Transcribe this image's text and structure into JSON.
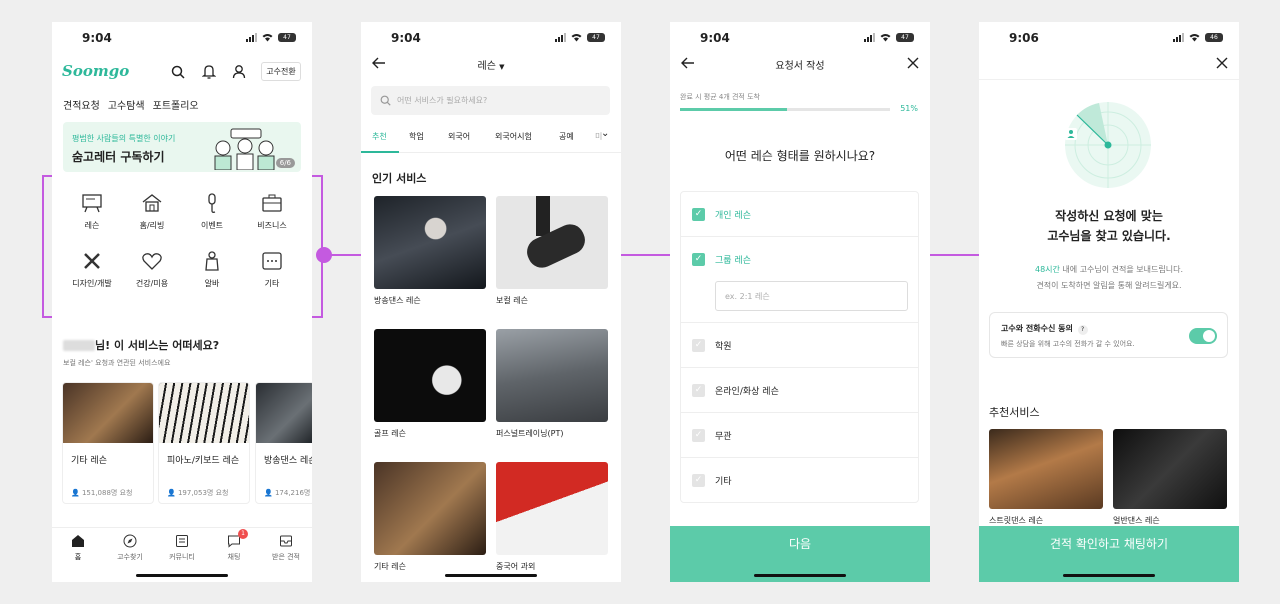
{
  "screens": [
    {
      "status_time": "9:04",
      "battery": "47",
      "logo": "Soomgo",
      "mode_switch": "고수전환",
      "tabs": [
        "견적요청",
        "고수탐색",
        "포트폴리오"
      ],
      "banner": {
        "subtitle": "평범한 사람들의 특별한 이야기",
        "title": "숨고레터 구독하기",
        "page": "6/6"
      },
      "categories": [
        "레슨",
        "홈/리빙",
        "이벤트",
        "비즈니스",
        "디자인/개발",
        "건강/미용",
        "알바",
        "기타"
      ],
      "rec_title": "님! 이 서비스는 어떠세요?",
      "rec_sub": "보컬 레슨' 요청과 연관된 서비스에요",
      "cards": [
        {
          "title": "기타 레슨",
          "count": "151,088명 요청"
        },
        {
          "title": "피아노/키보드 레슨",
          "count": "197,053명 요청"
        },
        {
          "title": "방송댄스 레슨",
          "count": "174,216명"
        }
      ],
      "nav": [
        "홈",
        "고수찾기",
        "커뮤니티",
        "채팅",
        "받은 견적"
      ],
      "chat_badge": "1"
    },
    {
      "status_time": "9:04",
      "battery": "47",
      "title": "레슨",
      "search_placeholder": "어떤 서비스가 필요하세요?",
      "tabs": [
        "추천",
        "학업",
        "외국어",
        "외국어시험",
        "공예",
        "미"
      ],
      "section": "인기 서비스",
      "items": [
        "방송댄스 레슨",
        "보컬 레슨",
        "골프 레슨",
        "퍼스널트레이닝(PT)",
        "기타 레슨",
        "중국어 과외"
      ]
    },
    {
      "status_time": "9:04",
      "battery": "47",
      "title": "요청서 작성",
      "progress_label": "완료 시 평균 4개 견적 도착",
      "progress_pct": "51%",
      "progress_value": 0.51,
      "question": "어떤 레슨 형태를 원하시나요?",
      "options": [
        {
          "label": "개인 레슨",
          "checked": true
        },
        {
          "label": "그룹 레슨",
          "checked": true
        },
        {
          "label": "학원",
          "checked": false
        },
        {
          "label": "온라인/화상 레슨",
          "checked": false
        },
        {
          "label": "무관",
          "checked": false
        },
        {
          "label": "기타",
          "checked": false
        }
      ],
      "group_placeholder": "ex. 2:1 레슨",
      "next_button": "다음"
    },
    {
      "status_time": "9:06",
      "battery": "46",
      "heading_line1": "작성하신 요청에 맞는",
      "heading_line2": "고수님을 찾고 있습니다.",
      "info_highlight": "48시간",
      "info_line1_rest": " 내에 고수님이 견적을 보내드립니다.",
      "info_line2": "견적이 도착하면 알림을 통해 알려드릴게요.",
      "consent_title": "고수와 전화수신 동의",
      "consent_help": "?",
      "consent_sub": "빠른 상담을 위해 고수의 전화가 갈 수 있어요.",
      "consent_on": true,
      "rec_title": "추천서비스",
      "rec_items": [
        "스트릿댄스 레슨",
        "얼반댄스 레슨"
      ],
      "cta": "견적 확인하고 채팅하기"
    }
  ],
  "colors": {
    "accent": "#2db89a",
    "button": "#5ccba9",
    "highlight": "#c45ae0"
  }
}
